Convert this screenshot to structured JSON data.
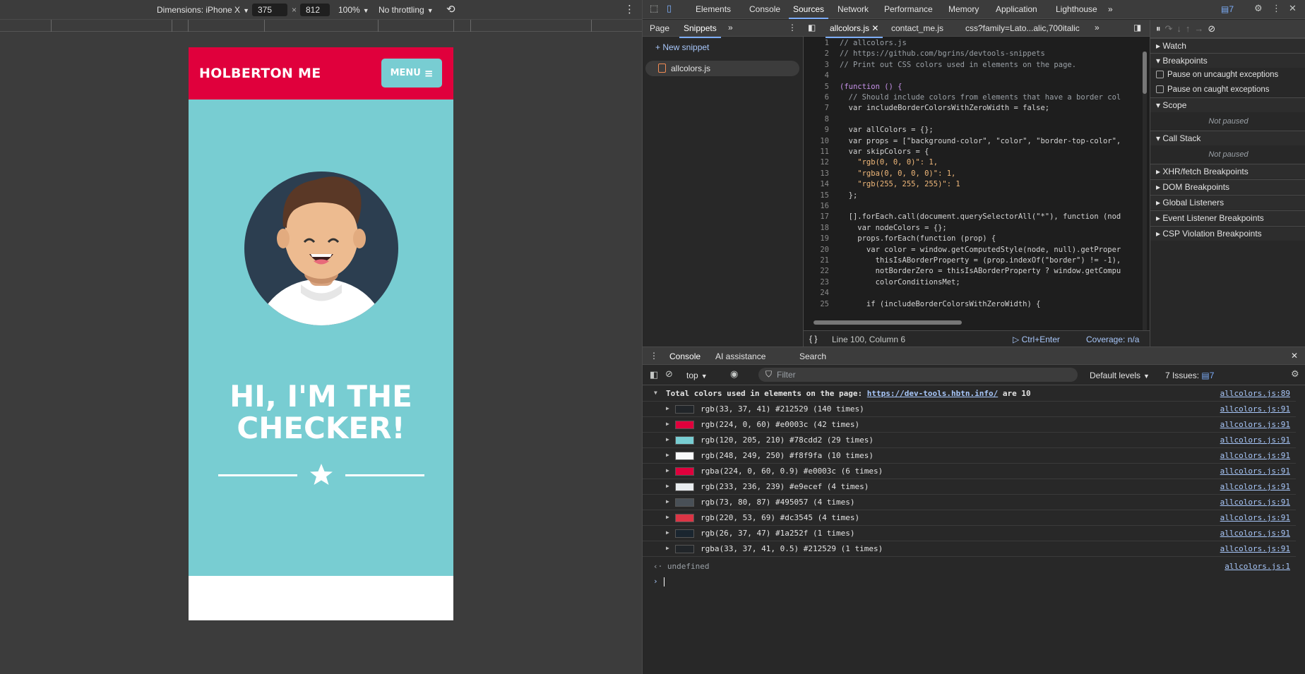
{
  "device_toolbar": {
    "dimensions_label": "Dimensions: iPhone X",
    "width": "375",
    "times": "×",
    "height": "812",
    "zoom": "100%",
    "throttle": "No throttling"
  },
  "page": {
    "brand": "HOLBERTON ME",
    "menu_label": "MENU",
    "hero_title_line1": "HI, I'M THE",
    "hero_title_line2": "CHECKER!",
    "colors": {
      "header": "#e0003c",
      "hero": "#78cdd2",
      "avatar_bg": "#2c3e50"
    }
  },
  "devtools": {
    "tabs": [
      "Elements",
      "Console",
      "Sources",
      "Network",
      "Performance",
      "Memory",
      "Application",
      "Lighthouse"
    ],
    "active_tab": "Sources",
    "issues_badge": "7",
    "nav_tabs": [
      "Page",
      "Snippets"
    ],
    "new_snippet": "+ New snippet",
    "snippet_file": "allcolors.js",
    "editor_tabs": [
      "allcolors.js",
      "contact_me.js",
      "css?family=Lato...alic,700italic"
    ],
    "code_lines": [
      {
        "n": "1",
        "t": "// allcolors.js",
        "c": "cm"
      },
      {
        "n": "2",
        "t": "// https://github.com/bgrins/devtools-snippets",
        "c": "cm"
      },
      {
        "n": "3",
        "t": "// Print out CSS colors used in elements on the page.",
        "c": "cm"
      },
      {
        "n": "4",
        "t": "",
        "c": ""
      },
      {
        "n": "5",
        "t": "(function () {",
        "c": "kw"
      },
      {
        "n": "6",
        "t": "  // Should include colors from elements that have a border col",
        "c": "cm"
      },
      {
        "n": "7",
        "t": "  var includeBorderColorsWithZeroWidth = false;",
        "c": ""
      },
      {
        "n": "8",
        "t": "",
        "c": ""
      },
      {
        "n": "9",
        "t": "  var allColors = {};",
        "c": ""
      },
      {
        "n": "10",
        "t": "  var props = [\"background-color\", \"color\", \"border-top-color\",",
        "c": ""
      },
      {
        "n": "11",
        "t": "  var skipColors = {",
        "c": ""
      },
      {
        "n": "12",
        "t": "    \"rgb(0, 0, 0)\": 1,",
        "c": "str"
      },
      {
        "n": "13",
        "t": "    \"rgba(0, 0, 0, 0)\": 1,",
        "c": "str"
      },
      {
        "n": "14",
        "t": "    \"rgb(255, 255, 255)\": 1",
        "c": "str"
      },
      {
        "n": "15",
        "t": "  };",
        "c": ""
      },
      {
        "n": "16",
        "t": "",
        "c": ""
      },
      {
        "n": "17",
        "t": "  [].forEach.call(document.querySelectorAll(\"*\"), function (nod",
        "c": ""
      },
      {
        "n": "18",
        "t": "    var nodeColors = {};",
        "c": ""
      },
      {
        "n": "19",
        "t": "    props.forEach(function (prop) {",
        "c": ""
      },
      {
        "n": "20",
        "t": "      var color = window.getComputedStyle(node, null).getProper",
        "c": ""
      },
      {
        "n": "21",
        "t": "        thisIsABorderProperty = (prop.indexOf(\"border\") != -1),",
        "c": ""
      },
      {
        "n": "22",
        "t": "        notBorderZero = thisIsABorderProperty ? window.getCompu",
        "c": ""
      },
      {
        "n": "23",
        "t": "        colorConditionsMet;",
        "c": ""
      },
      {
        "n": "24",
        "t": "",
        "c": ""
      },
      {
        "n": "25",
        "t": "      if (includeBorderColorsWithZeroWidth) {",
        "c": ""
      }
    ],
    "status_position": "Line 100, Column 6",
    "run_label": "Ctrl+Enter",
    "coverage": "Coverage: n/a",
    "right_pane": {
      "watch": "Watch",
      "breakpoints": "Breakpoints",
      "pause_uncaught": "Pause on uncaught exceptions",
      "pause_caught": "Pause on caught exceptions",
      "scope": "Scope",
      "scope_status": "Not paused",
      "call_stack": "Call Stack",
      "call_stack_status": "Not paused",
      "xhr": "XHR/fetch Breakpoints",
      "dom": "DOM Breakpoints",
      "global": "Global Listeners",
      "event": "Event Listener Breakpoints",
      "csp": "CSP Violation Breakpoints"
    },
    "drawer_tabs": [
      "Console",
      "AI assistance",
      "Search"
    ],
    "console_toolbar": {
      "context": "top",
      "filter_placeholder": "Filter",
      "levels": "Default levels",
      "issues": "7 Issues:",
      "issues_count": "7"
    },
    "console_summary": {
      "prefix": "Total colors used in elements on the page: ",
      "link": "https://dev-tools.hbtn.info/",
      "suffix": " are 10",
      "source": "allcolors.js:89"
    },
    "console_rows": [
      {
        "swatch": "#212529",
        "text": "rgb(33, 37, 41) #212529 (140 times)",
        "source": "allcolors.js:91"
      },
      {
        "swatch": "#e0003c",
        "text": "rgb(224, 0, 60) #e0003c (42 times)",
        "source": "allcolors.js:91"
      },
      {
        "swatch": "#78cdd2",
        "text": "rgb(120, 205, 210) #78cdd2 (29 times)",
        "source": "allcolors.js:91"
      },
      {
        "swatch": "#f8f9fa",
        "text": "rgb(248, 249, 250) #f8f9fa (10 times)",
        "source": "allcolors.js:91"
      },
      {
        "swatch": "#e0003c",
        "text": "rgba(224, 0, 60, 0.9) #e0003c (6 times)",
        "source": "allcolors.js:91"
      },
      {
        "swatch": "#e9ecef",
        "text": "rgb(233, 236, 239) #e9ecef (4 times)",
        "source": "allcolors.js:91"
      },
      {
        "swatch": "#495057",
        "text": "rgb(73, 80, 87) #495057 (4 times)",
        "source": "allcolors.js:91"
      },
      {
        "swatch": "#dc3545",
        "text": "rgb(220, 53, 69) #dc3545 (4 times)",
        "source": "allcolors.js:91"
      },
      {
        "swatch": "#1a252f",
        "text": "rgb(26, 37, 47) #1a252f (1 times)",
        "source": "allcolors.js:91"
      },
      {
        "swatch": "#212529",
        "text": "rgba(33, 37, 41, 0.5) #212529 (1 times)",
        "source": "allcolors.js:91"
      }
    ],
    "console_result": "undefined",
    "console_result_source": "allcolors.js:1"
  }
}
